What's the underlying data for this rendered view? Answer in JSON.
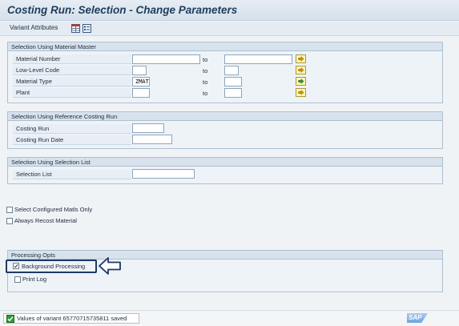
{
  "header": {
    "title": "Costing Run: Selection - Change Parameters"
  },
  "toolbar": {
    "variant_attributes_label": "Variant Attributes"
  },
  "groups": {
    "material_master": {
      "title": "Selection Using Material Master",
      "rows": [
        {
          "label": "Material Number",
          "from": "",
          "to_label": "to",
          "to": ""
        },
        {
          "label": "Low-Level Code",
          "from": "",
          "to_label": "to",
          "to": ""
        },
        {
          "label": "Material Type",
          "from": "ZMAT",
          "to_label": "to",
          "to": ""
        },
        {
          "label": "Plant",
          "from": "",
          "to_label": "to",
          "to": ""
        }
      ]
    },
    "reference_costing": {
      "title": "Selection Using Reference Costing Run",
      "rows": [
        {
          "label": "Costing Run",
          "value": ""
        },
        {
          "label": "Costing Run Date",
          "value": ""
        }
      ]
    },
    "selection_list": {
      "title": "Selection Using Selection List",
      "rows": [
        {
          "label": "Selection List",
          "value": ""
        }
      ]
    }
  },
  "options": {
    "select_configured": {
      "label": "Select Configured Matls Only",
      "checked": false
    },
    "always_recost": {
      "label": "Always Recost Material",
      "checked": false
    }
  },
  "processing": {
    "title": "Processing Opts",
    "background": {
      "label": "Background Processing",
      "checked": true
    },
    "print_log": {
      "label": "Print Log",
      "checked": false
    }
  },
  "status": {
    "message": "Values of variant 65770715735811 saved",
    "brand": "SAP"
  },
  "colors": {
    "title_text": "#1f3c5b",
    "group_header": "#d7e2ed",
    "highlight_border": "#1c3a66",
    "arrow_button": "#fff6b3",
    "status_ok": "#2e9b3a",
    "sap_logo": "#7fb0e3"
  },
  "icons": {
    "variant_attr_1": "table-icon",
    "variant_attr_2": "list-icon",
    "multi_select": "arrow-right-icon",
    "status": "success-check-icon",
    "callout": "arrow-left-outline-icon"
  }
}
